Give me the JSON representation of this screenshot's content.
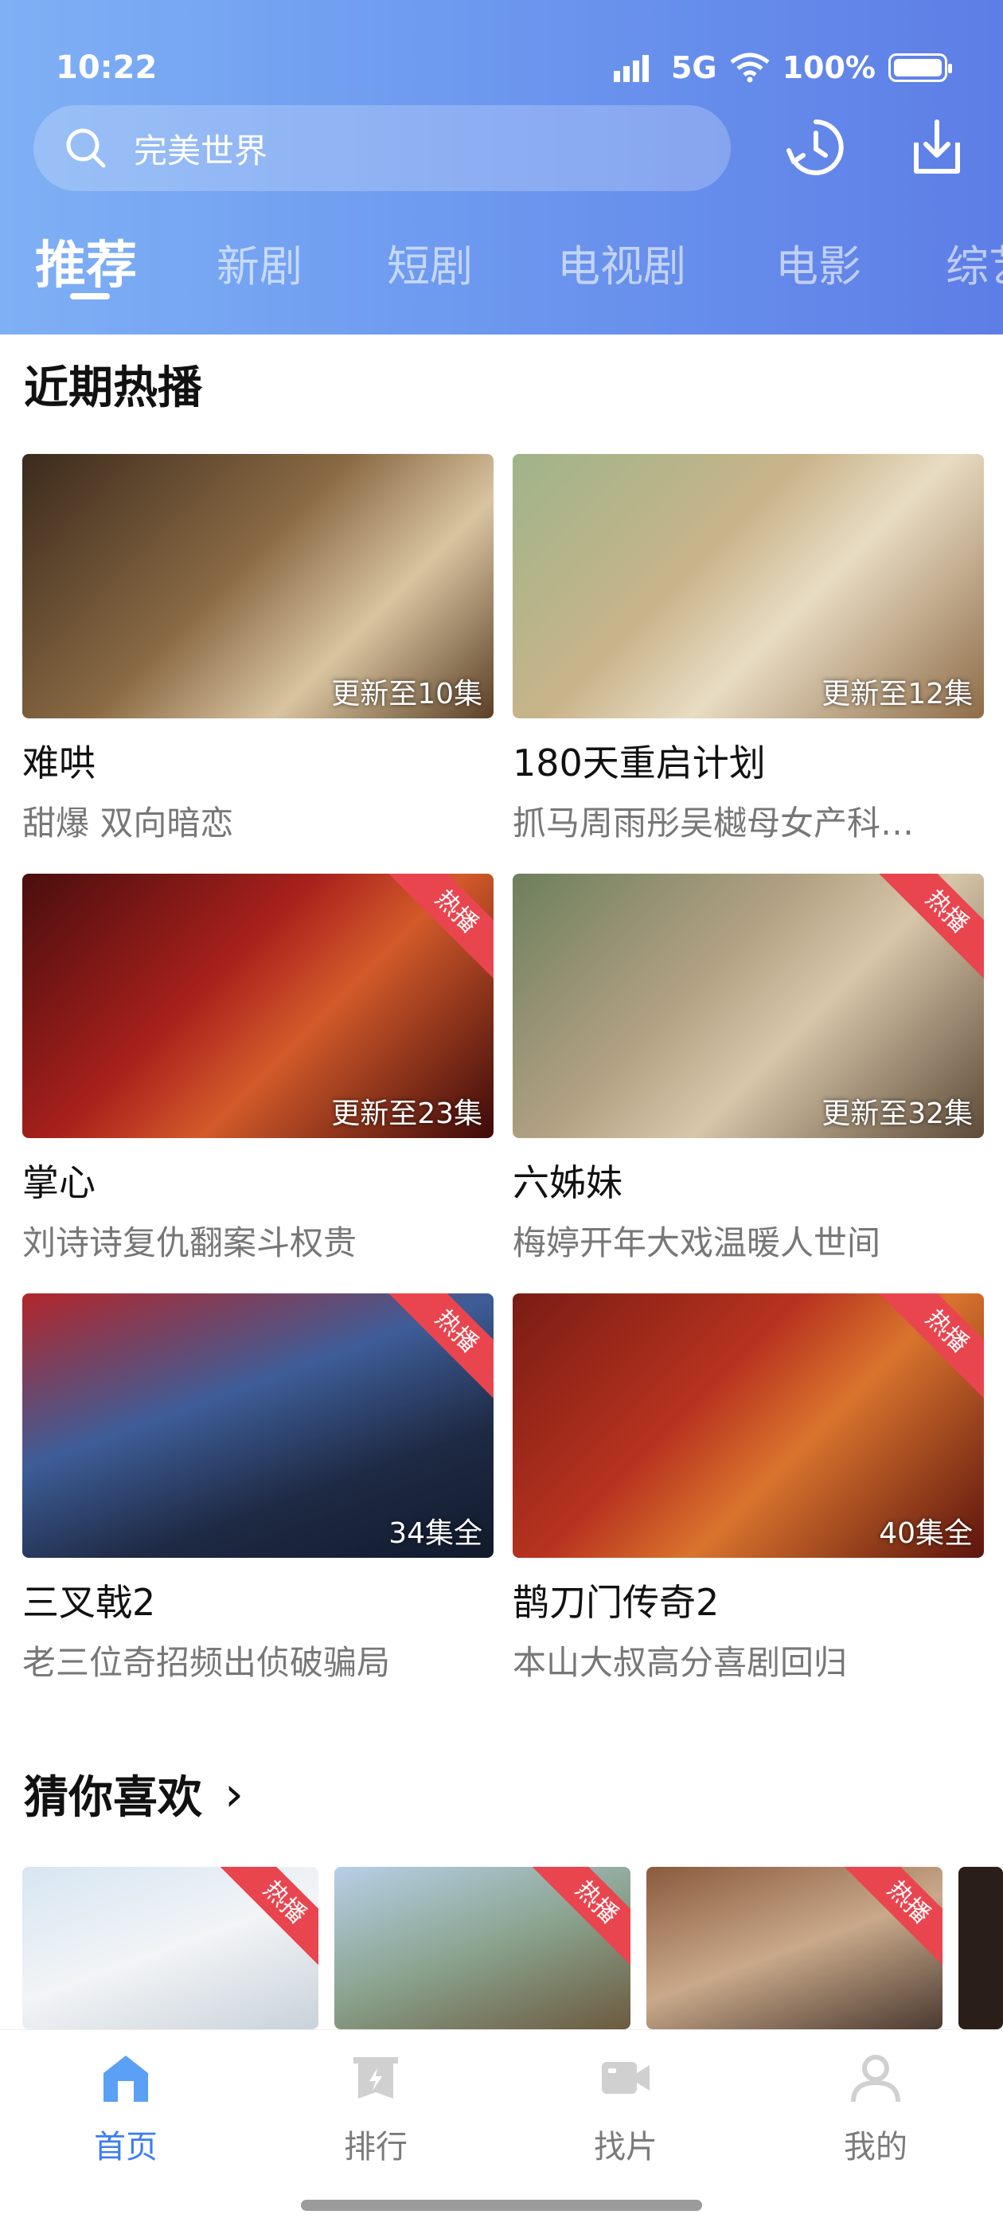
{
  "status_bar": {
    "time": "10:22",
    "network": "5G",
    "battery": "100%"
  },
  "search": {
    "text": "完美世界"
  },
  "tabs": [
    "推荐",
    "新剧",
    "短剧",
    "电视剧",
    "电影",
    "综艺"
  ],
  "recent_hot": {
    "title": "近期热播",
    "items": [
      {
        "title": "难哄",
        "subtitle": "甜爆 双向暗恋",
        "episode": "更新至10集",
        "hot": ""
      },
      {
        "title": "180天重启计划",
        "subtitle": "抓马周雨彤吴樾母女产科…",
        "episode": "更新至12集",
        "hot": ""
      },
      {
        "title": "掌心",
        "subtitle": "刘诗诗复仇翻案斗权贵",
        "episode": "更新至23集",
        "hot": "热播"
      },
      {
        "title": "六姊妹",
        "subtitle": "梅婷开年大戏温暖人世间",
        "episode": "更新至32集",
        "hot": "热播"
      },
      {
        "title": "三叉戟2",
        "subtitle": "老三位奇招频出侦破骗局",
        "episode": "34集全",
        "hot": "热播"
      },
      {
        "title": "鹊刀门传奇2",
        "subtitle": "本山大叔高分喜剧回归",
        "episode": "40集全",
        "hot": "热播"
      }
    ]
  },
  "guess_like": {
    "title": "猜你喜欢",
    "arrow": "›",
    "hot_label": "热播"
  },
  "bottom_nav": [
    "首页",
    "排行",
    "找片",
    "我的"
  ],
  "colors": {
    "accent": "#3d7ef0",
    "hot": "#e9454f"
  }
}
